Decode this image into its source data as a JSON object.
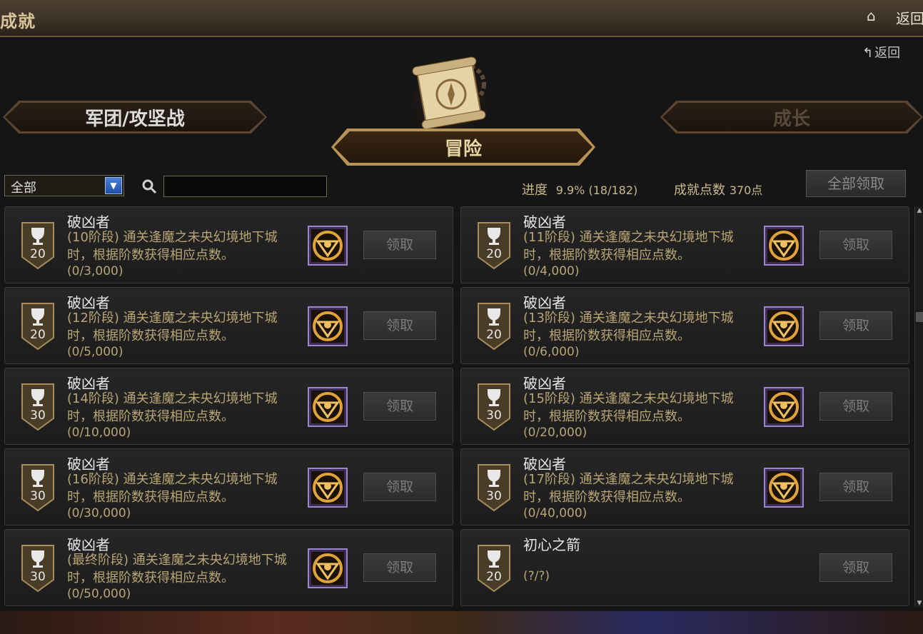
{
  "header": {
    "title": "成就",
    "back_label": "返回"
  },
  "back_button": {
    "label": "返回"
  },
  "tabs": {
    "legion": "军团/攻坚战",
    "adventure": "冒险",
    "growth": "成长"
  },
  "filter": {
    "selected": "全部",
    "search_value": ""
  },
  "stats": {
    "progress_label": "进度",
    "progress_value": "9.9% (18/182)",
    "points_label": "成就点数",
    "points_value": "370点"
  },
  "claim_all_label": "全部领取",
  "claim_label": "领取",
  "achievements": [
    {
      "points": "20",
      "title": "破凶者",
      "desc": "(10阶段) 通关逢魔之未央幻境地下城时，根据阶数获得相应点数。",
      "progress": "(0/3,000)"
    },
    {
      "points": "20",
      "title": "破凶者",
      "desc": "(11阶段) 通关逢魔之未央幻境地下城时，根据阶数获得相应点数。",
      "progress": "(0/4,000)"
    },
    {
      "points": "20",
      "title": "破凶者",
      "desc": "(12阶段) 通关逢魔之未央幻境地下城时，根据阶数获得相应点数。",
      "progress": "(0/5,000)"
    },
    {
      "points": "20",
      "title": "破凶者",
      "desc": "(13阶段) 通关逢魔之未央幻境地下城时，根据阶数获得相应点数。",
      "progress": "(0/6,000)"
    },
    {
      "points": "30",
      "title": "破凶者",
      "desc": "(14阶段) 通关逢魔之未央幻境地下城时，根据阶数获得相应点数。",
      "progress": "(0/10,000)"
    },
    {
      "points": "30",
      "title": "破凶者",
      "desc": "(15阶段) 通关逢魔之未央幻境地下城时，根据阶数获得相应点数。",
      "progress": "(0/20,000)"
    },
    {
      "points": "30",
      "title": "破凶者",
      "desc": "(16阶段) 通关逢魔之未央幻境地下城时，根据阶数获得相应点数。",
      "progress": "(0/30,000)"
    },
    {
      "points": "30",
      "title": "破凶者",
      "desc": "(17阶段) 通关逢魔之未央幻境地下城时，根据阶数获得相应点数。",
      "progress": "(0/40,000)"
    },
    {
      "points": "30",
      "title": "破凶者",
      "desc": "(最终阶段) 通关逢魔之未央幻境地下城时，根据阶数获得相应点数。",
      "progress": "(0/50,000)"
    },
    {
      "points": "20",
      "title": "初心之箭",
      "desc": "",
      "progress": "(?/?)"
    }
  ]
}
